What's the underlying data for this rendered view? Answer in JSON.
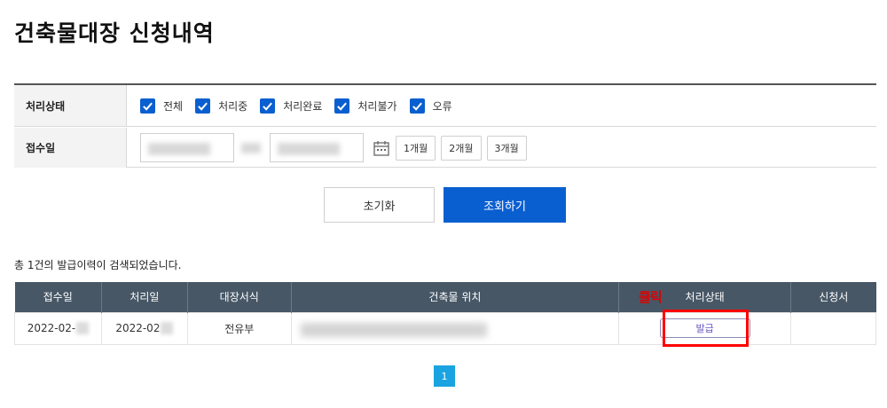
{
  "page_title": "건축물대장 신청내역",
  "filter": {
    "status_label": "처리상태",
    "status_options": [
      {
        "label": "전체",
        "checked": true
      },
      {
        "label": "처리중",
        "checked": true
      },
      {
        "label": "처리완료",
        "checked": true
      },
      {
        "label": "처리불가",
        "checked": true
      },
      {
        "label": "오류",
        "checked": true
      }
    ],
    "date_label": "접수일",
    "period_buttons": [
      "1개월",
      "2개월",
      "3개월"
    ]
  },
  "buttons": {
    "reset": "초기화",
    "search": "조회하기"
  },
  "result_summary": "총 1건의 발급이력이 검색되었습니다.",
  "table": {
    "headers": [
      "접수일",
      "처리일",
      "대장서식",
      "건축물 위치",
      "처리상태",
      "신청서"
    ],
    "rows": [
      {
        "received": "2022-02-",
        "processed": "2022-02",
        "form": "전유부",
        "location": "",
        "status_button": "발급",
        "application": ""
      }
    ]
  },
  "annotation": {
    "click_label": "클릭",
    "highlight_color": "#ff0000"
  },
  "pagination": {
    "current_page": "1"
  },
  "colors": {
    "primary": "#0a5fd0",
    "table_header": "#475766",
    "pager": "#1aa3e0"
  }
}
